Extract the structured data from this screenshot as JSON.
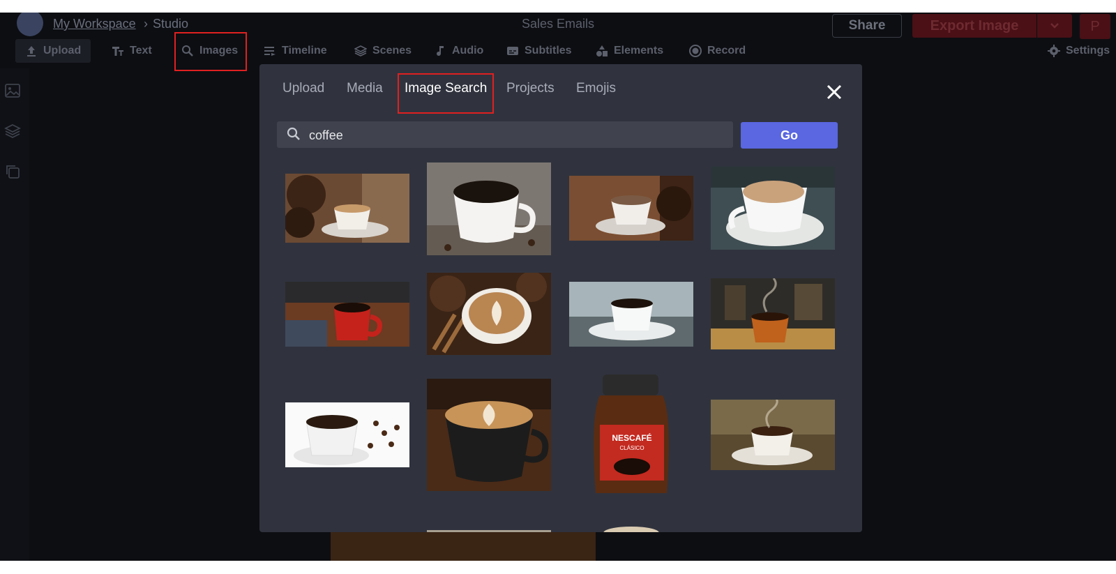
{
  "breadcrumb": {
    "workspace": "My Workspace",
    "separator": "›",
    "current": "Studio"
  },
  "project_title": "Sales Emails",
  "header": {
    "share_label": "Share",
    "export_label": "Export Image",
    "profile_initial": "P"
  },
  "toolbar": {
    "upload": "Upload",
    "text": "Text",
    "images": "Images",
    "timeline": "Timeline",
    "scenes": "Scenes",
    "audio": "Audio",
    "subtitles": "Subtitles",
    "elements": "Elements",
    "record": "Record",
    "settings": "Settings"
  },
  "modal": {
    "tabs": [
      "Upload",
      "Media",
      "Image Search",
      "Projects",
      "Emojis"
    ],
    "active_tab": "Image Search",
    "search_value": "coffee",
    "go_label": "Go",
    "results": [
      "coffee-cup-beans",
      "white-cup-black-coffee",
      "steaming-cup-beans",
      "espresso-cup-table",
      "red-mug-steam",
      "latte-art-beans",
      "white-cup-saucer",
      "steaming-orange-cup",
      "white-cup-scattered-beans",
      "latte-art-black-cup",
      "instant-coffee-jar",
      "cup-saucer-smoke"
    ],
    "jar_brand": "NESCAFÉ",
    "jar_variant": "CLÁSICO"
  },
  "colors": {
    "accent": "#5a67e0",
    "export": "#4a1016",
    "highlight": "#e02020"
  }
}
